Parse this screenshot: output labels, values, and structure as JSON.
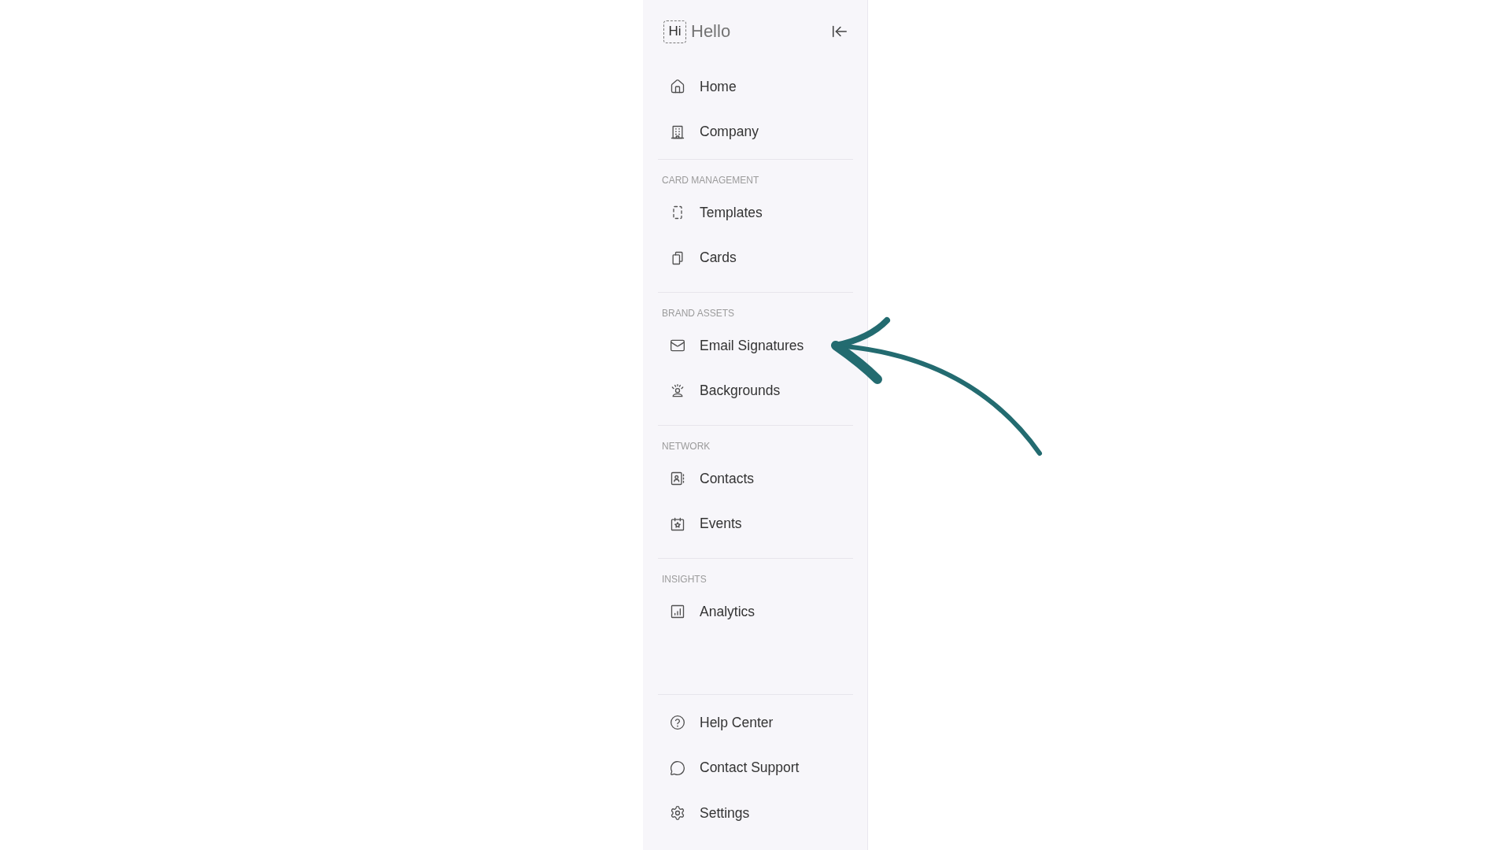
{
  "sidebar": {
    "logo": {
      "mark": "Hi",
      "text": "Hello"
    },
    "sections": [
      {
        "items": [
          {
            "label": "Home",
            "selected": false
          },
          {
            "label": "Company",
            "selected": false
          }
        ]
      },
      {
        "heading": "CARD MANAGEMENT",
        "items": [
          {
            "label": "Templates",
            "selected": false
          },
          {
            "label": "Cards",
            "selected": false
          }
        ]
      },
      {
        "heading": "BRAND ASSETS",
        "items": [
          {
            "label": "Email Signatures",
            "selected": false
          },
          {
            "label": "Backgrounds",
            "selected": false
          }
        ]
      },
      {
        "heading": "NETWORK",
        "items": [
          {
            "label": "Contacts",
            "selected": false
          },
          {
            "label": "Events",
            "selected": false
          }
        ]
      },
      {
        "heading": "INSIGHTS",
        "items": [
          {
            "label": "Analytics",
            "selected": false
          }
        ]
      }
    ],
    "footer_items": [
      {
        "label": "Help Center",
        "selected": false
      },
      {
        "label": "Contact Support",
        "selected": false
      },
      {
        "label": "Settings",
        "selected": false
      }
    ]
  }
}
